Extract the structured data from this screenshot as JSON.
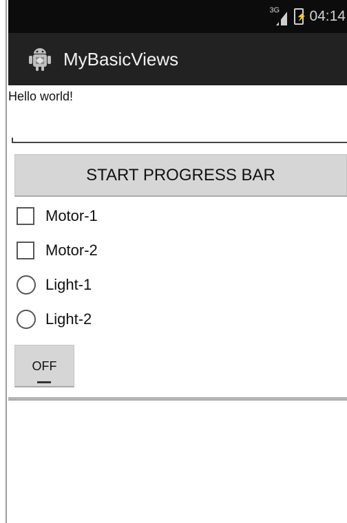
{
  "status_bar": {
    "network_label": "3G",
    "clock": "04:14"
  },
  "action_bar": {
    "title": "MyBasicViews",
    "icon": "android-robot-icon"
  },
  "content": {
    "hello_text": "Hello world!",
    "edit_text": {
      "value": "",
      "placeholder": ""
    },
    "progress_button_label": "START PROGRESS BAR",
    "checkboxes": [
      {
        "label": "Motor-1",
        "checked": false
      },
      {
        "label": "Motor-2",
        "checked": false
      }
    ],
    "radios": [
      {
        "label": "Light-1",
        "checked": false
      },
      {
        "label": "Light-2",
        "checked": false
      }
    ],
    "toggle_label": "OFF"
  }
}
